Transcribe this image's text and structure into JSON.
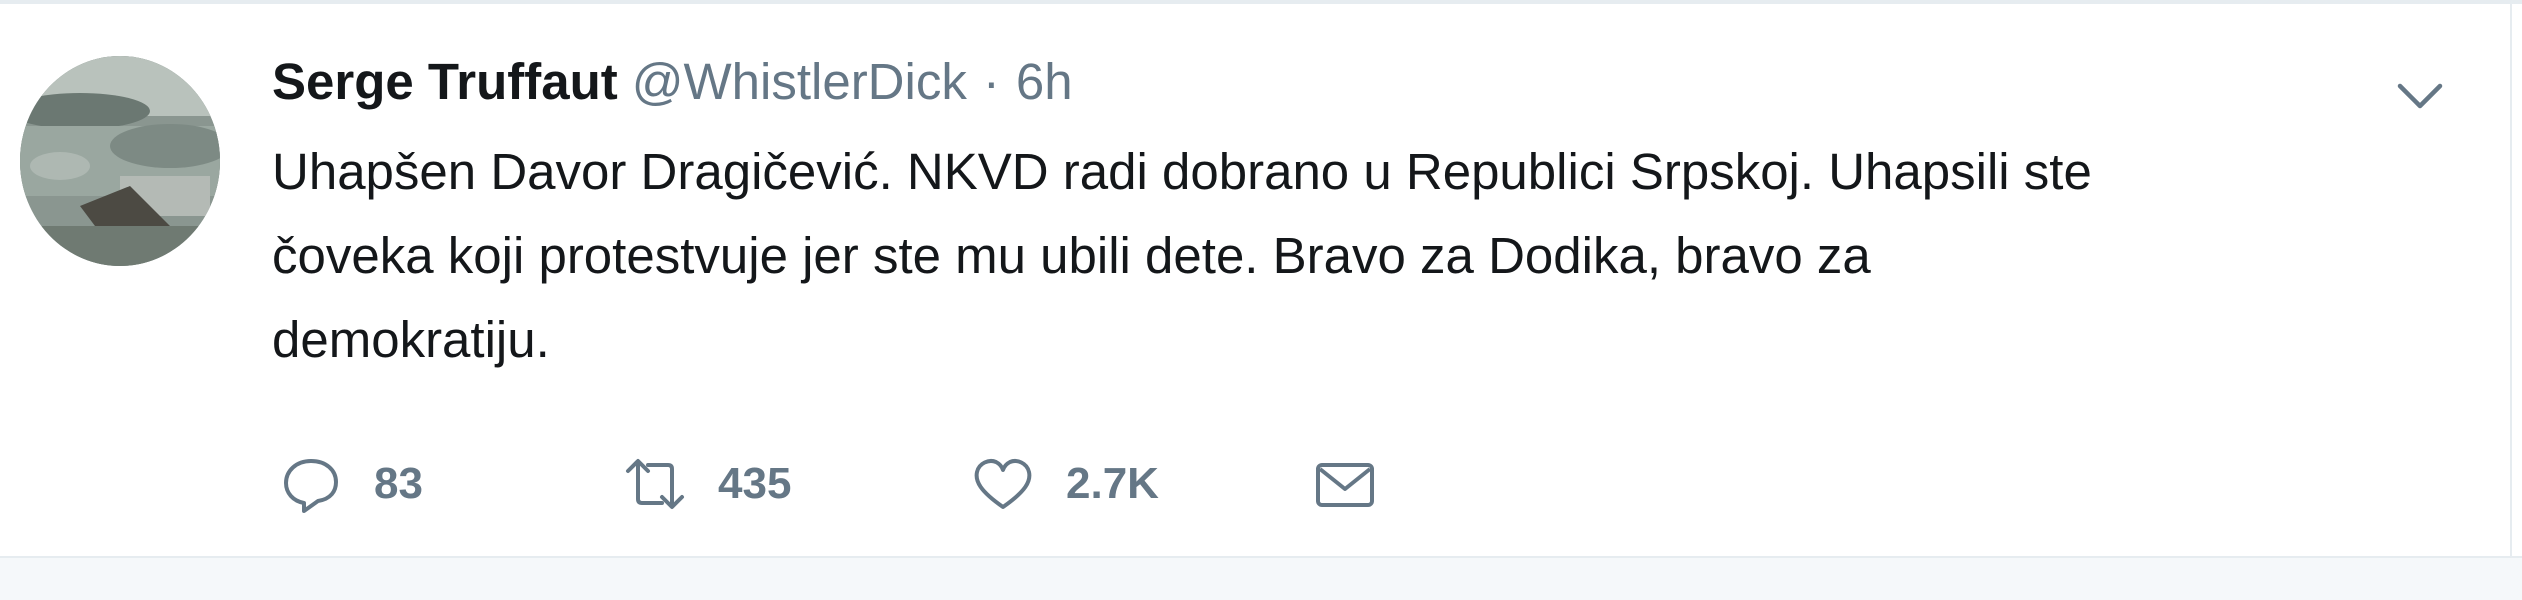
{
  "tweet": {
    "author_name": "Serge Truffaut",
    "handle": "@WhistlerDick",
    "separator": "·",
    "time": "6h",
    "text": "Uhapšen Davor Dragičević. NKVD radi dobrano u Republici Srpskoj. Uhapsili ste\nčoveka koji protestvuje jer ste mu ubili dete. Bravo za Dodika, bravo za\ndemokratiju.",
    "actions": {
      "reply_count": "83",
      "retweet_count": "435",
      "like_count": "2.7K"
    }
  },
  "icons": {
    "reply": "reply-icon",
    "retweet": "retweet-icon",
    "like": "heart-icon",
    "message": "envelope-icon",
    "menu": "chevron-down-icon"
  },
  "colors": {
    "text_primary": "#14171a",
    "text_secondary": "#657786",
    "border": "#e6ecf0"
  }
}
